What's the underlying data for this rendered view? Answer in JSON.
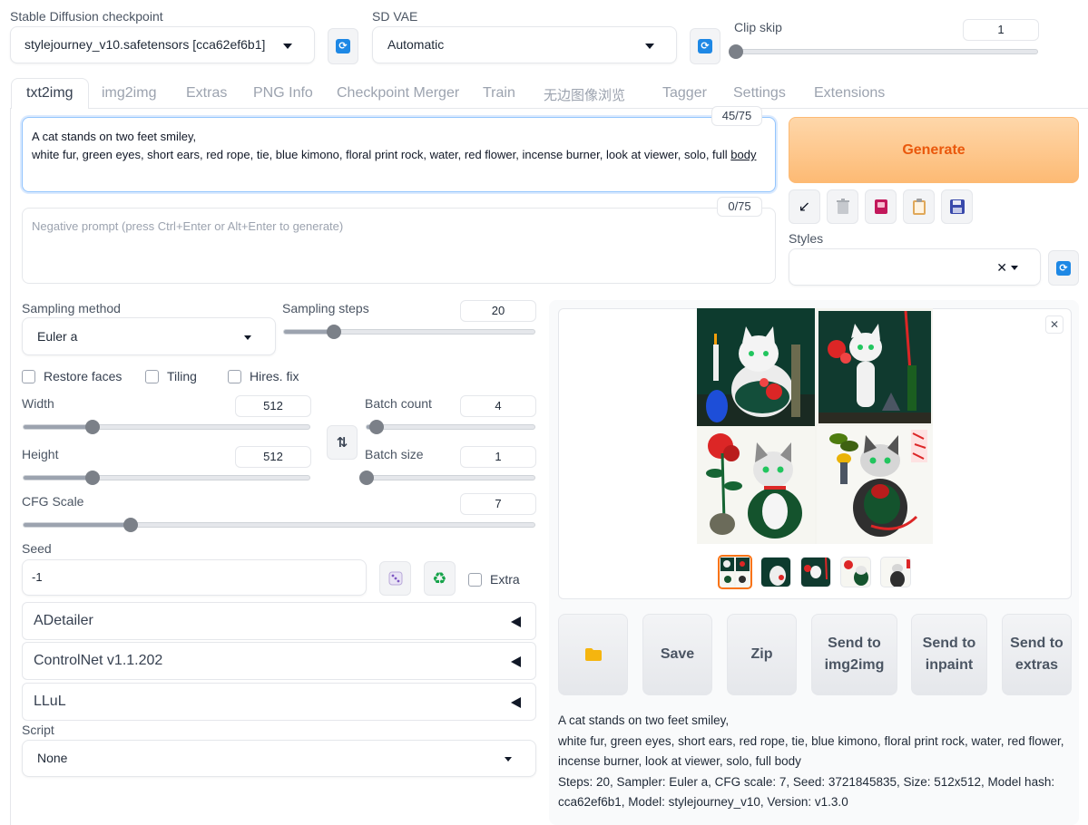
{
  "top": {
    "checkpoint_label": "Stable Diffusion checkpoint",
    "checkpoint_value": "stylejourney_v10.safetensors [cca62ef6b1]",
    "vae_label": "SD VAE",
    "vae_value": "Automatic",
    "clip_label": "Clip skip",
    "clip_value": "1"
  },
  "tabs": [
    "txt2img",
    "img2img",
    "Extras",
    "PNG Info",
    "Checkpoint Merger",
    "Train",
    "无边图像浏览",
    "Tagger",
    "Settings",
    "Extensions"
  ],
  "prompt": {
    "text_line1": "A cat stands on two feet smiley,",
    "text_line2_main": "white fur, green eyes, short ears, red rope, tie, blue kimono, floral print rock, water, red flower, incense burner, look at viewer, solo, full ",
    "text_line2_end": "body",
    "counter": "45/75",
    "neg_placeholder": "Negative prompt (press Ctrl+Enter or Alt+Enter to generate)",
    "neg_counter": "0/75"
  },
  "generate_label": "Generate",
  "styles_label": "Styles",
  "sampling": {
    "method_label": "Sampling method",
    "method_value": "Euler a",
    "steps_label": "Sampling steps",
    "steps_value": "20",
    "steps_fraction": 0.2
  },
  "checks": {
    "restore_faces": "Restore faces",
    "tiling": "Tiling",
    "hires": "Hires. fix"
  },
  "dims": {
    "width_label": "Width",
    "width_value": "512",
    "width_fraction": 0.24,
    "height_label": "Height",
    "height_value": "512",
    "height_fraction": 0.24,
    "batch_count_label": "Batch count",
    "batch_count_value": "4",
    "batch_count_fraction": 0.06,
    "batch_size_label": "Batch size",
    "batch_size_value": "1",
    "batch_size_fraction": 0.0
  },
  "cfg": {
    "label": "CFG Scale",
    "value": "7",
    "fraction": 0.21
  },
  "seed": {
    "label": "Seed",
    "value": "-1",
    "extra_label": "Extra"
  },
  "accordions": [
    "ADetailer",
    "ControlNet v1.1.202",
    "LLuL"
  ],
  "script": {
    "label": "Script",
    "value": "None"
  },
  "actions": {
    "save": "Save",
    "zip": "Zip",
    "send_img2img": "Send to img2img",
    "send_inpaint": "Send to inpaint",
    "send_extras": "Send to extras"
  },
  "output_info": {
    "line1": "A cat stands on two feet smiley,",
    "line2": "white fur, green eyes, short ears, red rope, tie, blue kimono, floral print rock, water, red flower, incense burner, look at viewer, solo, full body",
    "line3": "Steps: 20, Sampler: Euler a, CFG scale: 7, Seed: 3721845835, Size: 512x512, Model hash: cca62ef6b1, Model: stylejourney_v10, Version: v1.3.0"
  },
  "icons": {
    "refresh": "refresh-icon",
    "paste": "arrow-paste-icon",
    "trash": "trash-icon",
    "style_book": "book-icon",
    "clipboard": "clipboard-icon",
    "save": "floppy-icon",
    "dice": "dice-icon",
    "recycle": "recycle-icon",
    "folder": "folder-icon",
    "swap": "swap-icon",
    "close": "close-icon"
  },
  "colors": {
    "accent": "#1e88e5",
    "generate_text": "#ea580c",
    "generate_bg": "#fdba74"
  }
}
